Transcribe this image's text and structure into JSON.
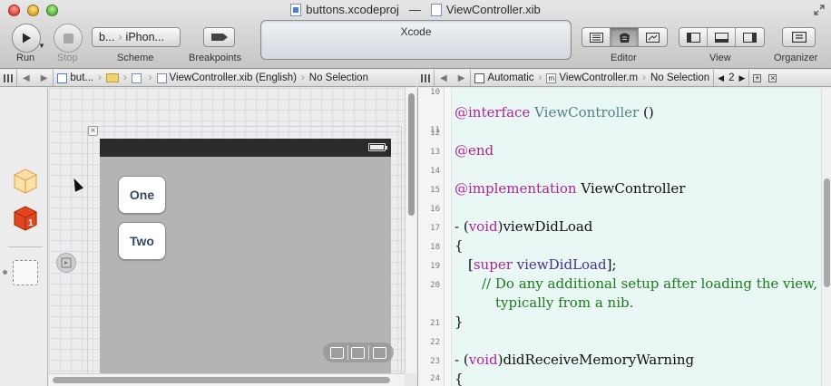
{
  "window": {
    "project_file": "buttons.xcodeproj",
    "title_separator": "—",
    "document_file": "ViewController.xib"
  },
  "toolbar": {
    "run_label": "Run",
    "stop_label": "Stop",
    "scheme_target": "b...",
    "scheme_device": "iPhon...",
    "scheme_label": "Scheme",
    "breakpoints_label": "Breakpoints",
    "activity_text": "Xcode",
    "editor_label": "Editor",
    "view_label": "View",
    "organizer_label": "Organizer"
  },
  "jumpbar_left": {
    "project": "but...",
    "file": "ViewController.xib (English)",
    "selection": "No Selection"
  },
  "jumpbar_right": {
    "mode": "Automatic",
    "file": "ViewController.m",
    "selection": "No Selection",
    "counter": "2"
  },
  "canvas": {
    "button_one": "One",
    "button_two": "Two"
  },
  "code": {
    "line_numbers": [
      "10",
      "11",
      "12",
      "13",
      "14",
      "15",
      "16",
      "17",
      "18",
      "19",
      "20",
      "21",
      "22",
      "23",
      "24"
    ],
    "l11_kw": "@interface",
    "l11_cls": "ViewController",
    "l11_rest": " ()",
    "l13_kw": "@end",
    "l15_kw": "@implementation",
    "l15_rest": " ViewController",
    "l17_a": "- (",
    "l17_kw": "void",
    "l17_b": ")viewDidLoad",
    "l18": "{",
    "l19_a": "[",
    "l19_kw": "super",
    "l19_b": " ",
    "l19_method": "viewDidLoad",
    "l19_c": "];",
    "l20_comment": "// Do any additional setup after loading the view,",
    "l20_comment_cont": "typically from a nib.",
    "l21": "}",
    "l23_a": "- (",
    "l23_kw": "void",
    "l23_b": ")didReceiveMemoryWarning",
    "l24": "{"
  },
  "colors": {
    "editor_background": "#eaf8f5",
    "keyword": "#b0239b",
    "class_name": "#4f8389",
    "comment": "#1c7a1c",
    "button_text": "#34466a"
  }
}
